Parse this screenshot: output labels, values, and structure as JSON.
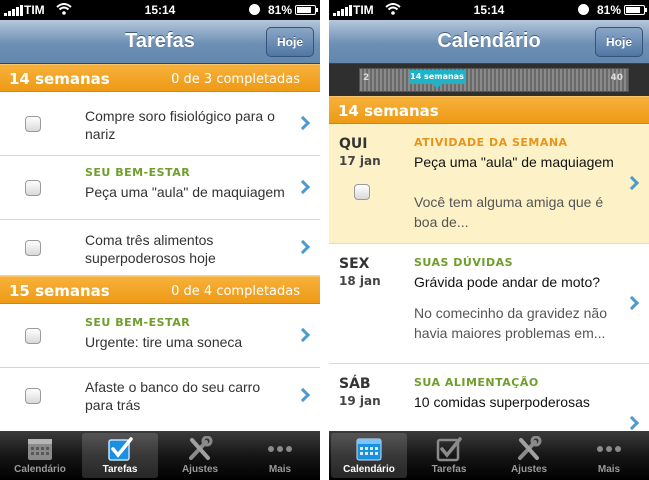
{
  "left": {
    "status": {
      "carrier": "TIM",
      "time": "15:14",
      "battery": "81%"
    },
    "nav": {
      "title": "Tarefas",
      "button": "Hoje"
    },
    "sections": [
      {
        "week": "14 semanas",
        "progress": "0 de 3 completadas",
        "tasks": [
          {
            "category": "",
            "text": "Compre soro fisiológico para o nariz"
          },
          {
            "category": "SEU BEM-ESTAR",
            "text": "Peça uma \"aula\" de maquiagem"
          },
          {
            "category": "",
            "text": "Coma três alimentos superpoderosos hoje"
          }
        ]
      },
      {
        "week": "15 semanas",
        "progress": "0 de 4 completadas",
        "tasks": [
          {
            "category": "SEU BEM-ESTAR",
            "text": "Urgente: tire uma soneca"
          },
          {
            "category": "",
            "text": "Afaste o banco do seu carro para trás"
          }
        ]
      }
    ],
    "tabs": [
      "Calendário",
      "Tarefas",
      "Ajustes",
      "Mais"
    ],
    "active_tab": "Tarefas"
  },
  "right": {
    "status": {
      "carrier": "TIM",
      "time": "15:14",
      "battery": "81%"
    },
    "nav": {
      "title": "Calendário",
      "button": "Hoje"
    },
    "timeline": {
      "min": "2",
      "max": "40",
      "current": "14 semanas"
    },
    "section": {
      "week": "14 semanas"
    },
    "days": [
      {
        "weekday": "QUI",
        "date": "17 jan",
        "category": "ATIVIDADE DA SEMANA",
        "category_color": "#e8941a",
        "title": "Peça uma \"aula\" de maquiagem",
        "desc": "Você tem alguma amiga que é boa de..."
      },
      {
        "weekday": "SEX",
        "date": "18 jan",
        "category": "SUAS DÚVIDAS",
        "category_color": "#6e9f2b",
        "title": "Grávida pode andar de moto?",
        "desc": "No comecinho da gravidez não havia maiores problemas em..."
      },
      {
        "weekday": "SÁB",
        "date": "19 jan",
        "category": "SUA ALIMENTAÇÃO",
        "category_color": "#6e9f2b",
        "title": "10 comidas superpoderosas",
        "desc": ""
      }
    ],
    "tabs": [
      "Calendário",
      "Tarefas",
      "Ajustes",
      "Mais"
    ],
    "active_tab": "Calendário"
  },
  "icons": {
    "status": [
      "signal-icon",
      "wifi-icon",
      "clock-icon",
      "battery-icon"
    ],
    "tabs": [
      "calendar-icon",
      "checkbox-icon",
      "tools-icon",
      "more-icon"
    ],
    "row": "chevron-right-icon"
  },
  "colors": {
    "orange": "#ee9a15",
    "green": "#6e9f2b",
    "blue_nav": "#6d8fb4",
    "chevron": "#4c9bd0",
    "highlight": "#fdf2c7",
    "timeline_marker": "#1fb3c7"
  }
}
